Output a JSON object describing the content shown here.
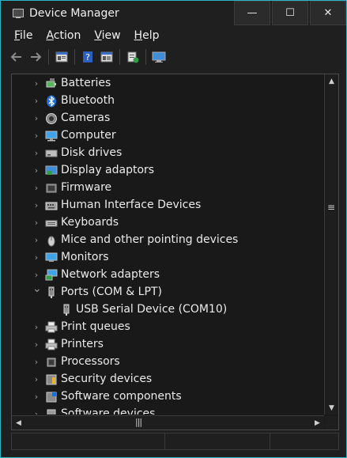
{
  "window": {
    "title": "Device Manager",
    "minimize": "—",
    "maximize": "☐",
    "close": "✕",
    "border_color": "#2bb5c7"
  },
  "menu": [
    {
      "label": "File",
      "accel": "F",
      "rest": "ile"
    },
    {
      "label": "Action",
      "accel": "A",
      "rest": "ction"
    },
    {
      "label": "View",
      "accel": "V",
      "rest": "iew"
    },
    {
      "label": "Help",
      "accel": "H",
      "rest": "elp"
    }
  ],
  "toolbar": {
    "back_icon": "arrow-left-icon",
    "forward_icon": "arrow-right-icon",
    "properties_icon": "properties-icon",
    "help_icon": "help-icon",
    "view_icon": "view-icon",
    "update_driver_icon": "update-driver-icon",
    "scan_icon": "scan-hardware-icon"
  },
  "tree": {
    "items": [
      {
        "label": "Batteries",
        "icon": "battery-icon",
        "expanded": false,
        "level": 1
      },
      {
        "label": "Bluetooth",
        "icon": "bluetooth-icon",
        "expanded": false,
        "level": 1
      },
      {
        "label": "Cameras",
        "icon": "camera-icon",
        "expanded": false,
        "level": 1
      },
      {
        "label": "Computer",
        "icon": "computer-icon",
        "expanded": false,
        "level": 1
      },
      {
        "label": "Disk drives",
        "icon": "disk-drive-icon",
        "expanded": false,
        "level": 1
      },
      {
        "label": "Display adaptors",
        "icon": "display-adapter-icon",
        "expanded": false,
        "level": 1
      },
      {
        "label": "Firmware",
        "icon": "firmware-icon",
        "expanded": false,
        "level": 1
      },
      {
        "label": "Human Interface Devices",
        "icon": "hid-icon",
        "expanded": false,
        "level": 1
      },
      {
        "label": "Keyboards",
        "icon": "keyboard-icon",
        "expanded": false,
        "level": 1
      },
      {
        "label": "Mice and other pointing devices",
        "icon": "mouse-icon",
        "expanded": false,
        "level": 1
      },
      {
        "label": "Monitors",
        "icon": "monitor-icon",
        "expanded": false,
        "level": 1
      },
      {
        "label": "Network adapters",
        "icon": "network-adapter-icon",
        "expanded": false,
        "level": 1
      },
      {
        "label": "Ports (COM & LPT)",
        "icon": "port-icon",
        "expanded": true,
        "level": 1
      },
      {
        "label": "USB Serial Device (COM10)",
        "icon": "port-icon",
        "expanded": null,
        "level": 2
      },
      {
        "label": "Print queues",
        "icon": "printer-icon",
        "expanded": false,
        "level": 1
      },
      {
        "label": "Printers",
        "icon": "printer-icon",
        "expanded": false,
        "level": 1
      },
      {
        "label": "Processors",
        "icon": "processor-icon",
        "expanded": false,
        "level": 1
      },
      {
        "label": "Security devices",
        "icon": "security-device-icon",
        "expanded": false,
        "level": 1
      },
      {
        "label": "Software components",
        "icon": "software-component-icon",
        "expanded": false,
        "level": 1
      },
      {
        "label": "Software devices",
        "icon": "software-device-icon",
        "expanded": false,
        "level": 1
      }
    ]
  },
  "scrollbar": {
    "up": "▲",
    "down": "▼",
    "left": "◀",
    "right": "▶",
    "v_grip": "≡",
    "h_grip": "|||"
  }
}
